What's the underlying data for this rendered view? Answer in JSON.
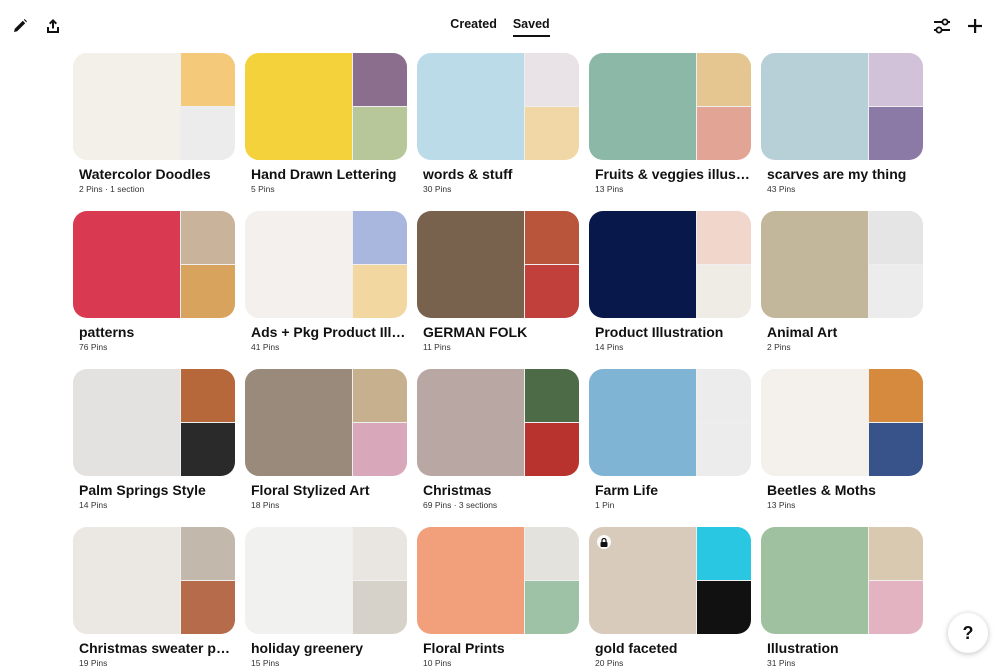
{
  "header": {
    "icons": {
      "edit": "pencil-icon",
      "share": "share-icon",
      "filter": "filter-icon",
      "add": "plus-icon"
    },
    "tabs": [
      {
        "label": "Created",
        "active": false
      },
      {
        "label": "Saved",
        "active": true
      }
    ]
  },
  "boards": [
    {
      "title": "Watercolor Doodles",
      "meta": "2 Pins · 1 section",
      "colors": [
        "#f3f0ea",
        "#f5c97a",
        "#ececec"
      ],
      "locked": false
    },
    {
      "title": "Hand Drawn Lettering",
      "meta": "5 Pins",
      "colors": [
        "#f4d23c",
        "#8b6d8e",
        "#b7c79a"
      ],
      "locked": false
    },
    {
      "title": "words & stuff",
      "meta": "30 Pins",
      "colors": [
        "#bcdbe9",
        "#e9e2e7",
        "#f2d7a6"
      ],
      "locked": false
    },
    {
      "title": "Fruits & veggies illustr...",
      "meta": "13 Pins",
      "colors": [
        "#8cb8a8",
        "#e5c590",
        "#e2a494"
      ],
      "locked": false
    },
    {
      "title": "scarves are my thing",
      "meta": "43 Pins",
      "colors": [
        "#b7cfd6",
        "#d1c2d9",
        "#8c7aa6"
      ],
      "locked": false
    },
    {
      "title": "patterns",
      "meta": "76 Pins",
      "colors": [
        "#d93a52",
        "#c9b49b",
        "#d7a35d"
      ],
      "locked": false
    },
    {
      "title": "Ads + Pkg Product Illu...",
      "meta": "41 Pins",
      "colors": [
        "#f3f0ed",
        "#a9b6de",
        "#f3d7a1"
      ],
      "locked": false
    },
    {
      "title": "GERMAN FOLK",
      "meta": "11 Pins",
      "colors": [
        "#78624d",
        "#b9553a",
        "#c2403c"
      ],
      "locked": false
    },
    {
      "title": "Product Illustration",
      "meta": "14 Pins",
      "colors": [
        "#08184a",
        "#f1d6cc",
        "#efece6"
      ],
      "locked": false
    },
    {
      "title": "Animal Art",
      "meta": "2 Pins",
      "colors": [
        "#c2b79b",
        "#e5e5e5",
        "#ececec"
      ],
      "locked": false
    },
    {
      "title": "Palm Springs Style",
      "meta": "14 Pins",
      "colors": [
        "#e4e2e0",
        "#b6683a",
        "#2a2a2a"
      ],
      "locked": false
    },
    {
      "title": "Floral Stylized Art",
      "meta": "18 Pins",
      "colors": [
        "#9a8a7b",
        "#c6b08e",
        "#d9a7ba"
      ],
      "locked": false
    },
    {
      "title": "Christmas",
      "meta": "69 Pins · 3 sections",
      "colors": [
        "#b9a7a4",
        "#4c6b46",
        "#b8322e"
      ],
      "locked": false
    },
    {
      "title": "Farm Life",
      "meta": "1 Pin",
      "colors": [
        "#7fb4d5",
        "#ececec",
        "#ececec"
      ],
      "locked": false
    },
    {
      "title": "Beetles & Moths",
      "meta": "13 Pins",
      "colors": [
        "#f4f1ec",
        "#d68a3e",
        "#38538a"
      ],
      "locked": false
    },
    {
      "title": "Christmas sweater pa...",
      "meta": "19 Pins",
      "colors": [
        "#ebe7e2",
        "#c2b8ab",
        "#b66c4a"
      ],
      "locked": false
    },
    {
      "title": "holiday greenery",
      "meta": "15 Pins",
      "colors": [
        "#f1f1ef",
        "#e9e6e1",
        "#d7d2c9"
      ],
      "locked": false
    },
    {
      "title": "Floral Prints",
      "meta": "10 Pins",
      "colors": [
        "#f1a07b",
        "#e4e2dc",
        "#9ec2a5"
      ],
      "locked": false
    },
    {
      "title": "gold faceted",
      "meta": "20 Pins",
      "colors": [
        "#d9cbbb",
        "#29c7e2",
        "#111111"
      ],
      "locked": true
    },
    {
      "title": "Illustration",
      "meta": "31 Pins",
      "colors": [
        "#9fc19f",
        "#d9c9b1",
        "#e3b3c1"
      ],
      "locked": false
    }
  ],
  "help": {
    "label": "?"
  }
}
